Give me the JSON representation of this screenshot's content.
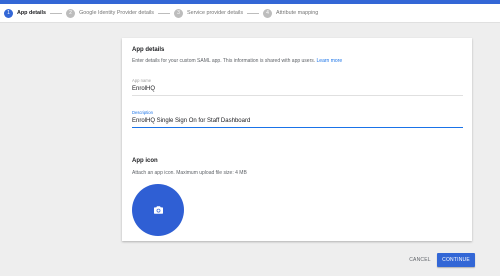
{
  "stepper": {
    "steps": [
      {
        "number": "1",
        "label": "App details",
        "active": true
      },
      {
        "number": "2",
        "label": "Google Identity Provider details",
        "active": false
      },
      {
        "number": "3",
        "label": "Service provider details",
        "active": false
      },
      {
        "number": "4",
        "label": "Attribute mapping",
        "active": false
      }
    ]
  },
  "app_details": {
    "title": "App details",
    "description": "Enter details for your custom SAML app. This information is shared with app users.",
    "learn_more": "Learn more",
    "app_name": {
      "label": "App name",
      "value": "EnrolHQ"
    },
    "app_description": {
      "label": "Description",
      "value": "EnrolHQ Single Sign On for Staff Dashboard"
    }
  },
  "app_icon": {
    "title": "App icon",
    "description": "Attach an app icon. Maximum upload file size: 4 MB",
    "upload_icon": "camera-icon"
  },
  "actions": {
    "cancel": "CANCEL",
    "continue": "CONTINUE"
  },
  "colors": {
    "accent": "#3367d6",
    "upload_circle": "#2f5fd4",
    "link": "#1a73e8",
    "background": "#eeeeee"
  }
}
